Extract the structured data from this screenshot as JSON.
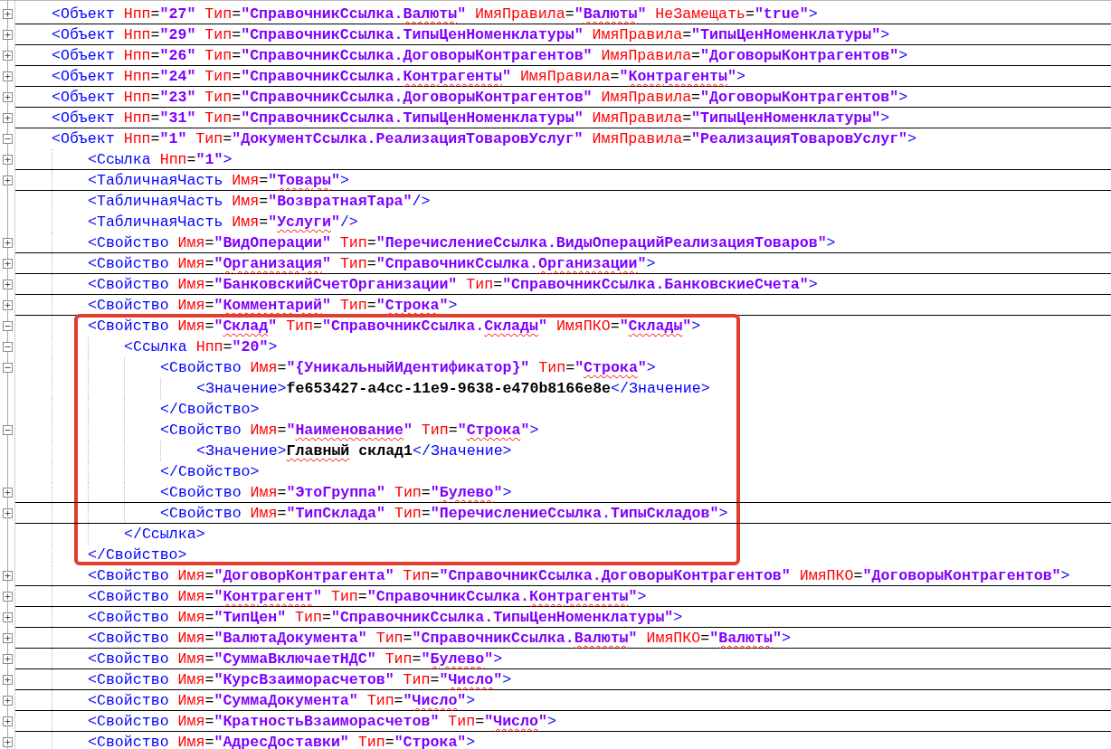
{
  "editor": {
    "lines": [
      {
        "kind": "fold",
        "expanded": false,
        "highlighted": false,
        "tokens": [
          {
            "kind": "tag",
            "text": "<Объект"
          },
          {
            "kind": "attr",
            "text": " Нпп"
          },
          {
            "kind": "eq",
            "text": "="
          },
          {
            "kind": "value",
            "text": "\"27\""
          },
          {
            "kind": "attr",
            "text": " Тип"
          },
          {
            "kind": "eq",
            "text": "="
          },
          {
            "kind": "value",
            "text": "\"СправочникСсылка."
          },
          {
            "kind": "value",
            "text": "Валюты",
            "misspelled": true
          },
          {
            "kind": "value",
            "text": "\""
          },
          {
            "kind": "attr",
            "text": " ИмяПравила"
          },
          {
            "kind": "eq",
            "text": "="
          },
          {
            "kind": "value",
            "text": "\""
          },
          {
            "kind": "value",
            "text": "Валюты",
            "misspelled": true
          },
          {
            "kind": "value",
            "text": "\""
          },
          {
            "kind": "attr",
            "text": " НеЗамещать"
          },
          {
            "kind": "eq",
            "text": "="
          },
          {
            "kind": "value",
            "text": "\"true\""
          },
          {
            "kind": "tag",
            "text": ">"
          }
        ]
      },
      {
        "kind": "fold",
        "expanded": false,
        "highlighted": false,
        "tokens": [
          {
            "kind": "tag",
            "text": "<Объект"
          },
          {
            "kind": "attr",
            "text": " Нпп"
          },
          {
            "kind": "eq",
            "text": "="
          },
          {
            "kind": "value",
            "text": "\"29\""
          },
          {
            "kind": "attr",
            "text": " Тип"
          },
          {
            "kind": "eq",
            "text": "="
          },
          {
            "kind": "value",
            "text": "\"СправочникСсылка.ТипыЦенНоменклатуры\""
          },
          {
            "kind": "attr",
            "text": " ИмяПравила"
          },
          {
            "kind": "eq",
            "text": "="
          },
          {
            "kind": "value",
            "text": "\"ТипыЦенНоменклатуры\""
          },
          {
            "kind": "tag",
            "text": ">"
          }
        ]
      },
      {
        "kind": "fold",
        "expanded": false,
        "highlighted": false,
        "tokens": [
          {
            "kind": "tag",
            "text": "<Объект"
          },
          {
            "kind": "attr",
            "text": " Нпп"
          },
          {
            "kind": "eq",
            "text": "="
          },
          {
            "kind": "value",
            "text": "\"26\""
          },
          {
            "kind": "attr",
            "text": " Тип"
          },
          {
            "kind": "eq",
            "text": "="
          },
          {
            "kind": "value",
            "text": "\"СправочникСсылка.ДоговорыКонтрагентов\""
          },
          {
            "kind": "attr",
            "text": " ИмяПравила"
          },
          {
            "kind": "eq",
            "text": "="
          },
          {
            "kind": "value",
            "text": "\"ДоговорыКонтрагентов\""
          },
          {
            "kind": "tag",
            "text": ">"
          }
        ]
      },
      {
        "kind": "fold",
        "expanded": false,
        "highlighted": false,
        "tokens": [
          {
            "kind": "tag",
            "text": "<Объект"
          },
          {
            "kind": "attr",
            "text": " Нпп"
          },
          {
            "kind": "eq",
            "text": "="
          },
          {
            "kind": "value",
            "text": "\"24\""
          },
          {
            "kind": "attr",
            "text": " Тип"
          },
          {
            "kind": "eq",
            "text": "="
          },
          {
            "kind": "value",
            "text": "\"СправочникСсылка."
          },
          {
            "kind": "value",
            "text": "Контрагенты",
            "misspelled": true
          },
          {
            "kind": "value",
            "text": "\""
          },
          {
            "kind": "attr",
            "text": " ИмяПравила"
          },
          {
            "kind": "eq",
            "text": "="
          },
          {
            "kind": "value",
            "text": "\""
          },
          {
            "kind": "value",
            "text": "Контрагенты",
            "misspelled": true
          },
          {
            "kind": "value",
            "text": "\""
          },
          {
            "kind": "tag",
            "text": ">"
          }
        ]
      },
      {
        "kind": "fold",
        "expanded": false,
        "highlighted": false,
        "tokens": [
          {
            "kind": "tag",
            "text": "<Объект"
          },
          {
            "kind": "attr",
            "text": " Нпп"
          },
          {
            "kind": "eq",
            "text": "="
          },
          {
            "kind": "value",
            "text": "\"23\""
          },
          {
            "kind": "attr",
            "text": " Тип"
          },
          {
            "kind": "eq",
            "text": "="
          },
          {
            "kind": "value",
            "text": "\"СправочникСсылка.ДоговорыКонтрагентов\""
          },
          {
            "kind": "attr",
            "text": " ИмяПравила"
          },
          {
            "kind": "eq",
            "text": "="
          },
          {
            "kind": "value",
            "text": "\"ДоговорыКонтрагентов\""
          },
          {
            "kind": "tag",
            "text": ">"
          }
        ]
      },
      {
        "kind": "fold",
        "expanded": false,
        "highlighted": false,
        "tokens": [
          {
            "kind": "tag",
            "text": "<Объект"
          },
          {
            "kind": "attr",
            "text": " Нпп"
          },
          {
            "kind": "eq",
            "text": "="
          },
          {
            "kind": "value",
            "text": "\"31\""
          },
          {
            "kind": "attr",
            "text": " Тип"
          },
          {
            "kind": "eq",
            "text": "="
          },
          {
            "kind": "value",
            "text": "\"СправочникСсылка.ТипыЦенНоменклатуры\""
          },
          {
            "kind": "attr",
            "text": " ИмяПравила"
          },
          {
            "kind": "eq",
            "text": "="
          },
          {
            "kind": "value",
            "text": "\"ТипыЦенНоменклатуры\""
          },
          {
            "kind": "tag",
            "text": ">"
          }
        ]
      },
      {
        "kind": "fold",
        "expanded": true,
        "highlighted": false,
        "tokens": [
          {
            "kind": "tag",
            "text": "<Объект"
          },
          {
            "kind": "attr",
            "text": " Нпп"
          },
          {
            "kind": "eq",
            "text": "="
          },
          {
            "kind": "value",
            "text": "\"1\""
          },
          {
            "kind": "attr",
            "text": " Тип"
          },
          {
            "kind": "eq",
            "text": "="
          },
          {
            "kind": "value",
            "text": "\"ДокументСсылка.РеализацияТоваровУслуг\""
          },
          {
            "kind": "attr",
            "text": " ИмяПравила"
          },
          {
            "kind": "eq",
            "text": "="
          },
          {
            "kind": "value",
            "text": "\"РеализацияТоваровУслуг\""
          },
          {
            "kind": "tag",
            "text": ">"
          }
        ],
        "children": [
          {
            "kind": "fold",
            "expanded": false,
            "highlighted": false,
            "tokens": [
              {
                "kind": "tag",
                "text": "<Ссылка"
              },
              {
                "kind": "attr",
                "text": " Нпп"
              },
              {
                "kind": "eq",
                "text": "="
              },
              {
                "kind": "value",
                "text": "\"1\""
              },
              {
                "kind": "tag",
                "text": ">"
              }
            ]
          },
          {
            "kind": "fold",
            "expanded": false,
            "highlighted": false,
            "tokens": [
              {
                "kind": "tag",
                "text": "<ТабличнаяЧасть"
              },
              {
                "kind": "attr",
                "text": " Имя"
              },
              {
                "kind": "eq",
                "text": "="
              },
              {
                "kind": "value",
                "text": "\""
              },
              {
                "kind": "value",
                "text": "Товары",
                "misspelled": true
              },
              {
                "kind": "value",
                "text": "\""
              },
              {
                "kind": "tag",
                "text": ">"
              }
            ]
          },
          {
            "kind": "leaf",
            "highlighted": false,
            "tokens": [
              {
                "kind": "tag",
                "text": "<ТабличнаяЧасть"
              },
              {
                "kind": "attr",
                "text": " Имя"
              },
              {
                "kind": "eq",
                "text": "="
              },
              {
                "kind": "value",
                "text": "\"ВозвратнаяТара\""
              },
              {
                "kind": "tag",
                "text": "/>"
              }
            ]
          },
          {
            "kind": "leaf",
            "highlighted": false,
            "tokens": [
              {
                "kind": "tag",
                "text": "<ТабличнаяЧасть"
              },
              {
                "kind": "attr",
                "text": " Имя"
              },
              {
                "kind": "eq",
                "text": "="
              },
              {
                "kind": "value",
                "text": "\""
              },
              {
                "kind": "value",
                "text": "Услуги",
                "misspelled": true
              },
              {
                "kind": "value",
                "text": "\""
              },
              {
                "kind": "tag",
                "text": "/>"
              }
            ]
          },
          {
            "kind": "fold",
            "expanded": false,
            "highlighted": false,
            "tokens": [
              {
                "kind": "tag",
                "text": "<Свойство"
              },
              {
                "kind": "attr",
                "text": " Имя"
              },
              {
                "kind": "eq",
                "text": "="
              },
              {
                "kind": "value",
                "text": "\"ВидОперации\""
              },
              {
                "kind": "attr",
                "text": " Тип"
              },
              {
                "kind": "eq",
                "text": "="
              },
              {
                "kind": "value",
                "text": "\"ПеречислениеСсылка.ВидыОперацийРеализацияТоваров\""
              },
              {
                "kind": "tag",
                "text": ">"
              }
            ]
          },
          {
            "kind": "fold",
            "expanded": false,
            "highlighted": false,
            "tokens": [
              {
                "kind": "tag",
                "text": "<Свойство"
              },
              {
                "kind": "attr",
                "text": " Имя"
              },
              {
                "kind": "eq",
                "text": "="
              },
              {
                "kind": "value",
                "text": "\""
              },
              {
                "kind": "value",
                "text": "Организация",
                "misspelled": true
              },
              {
                "kind": "value",
                "text": "\""
              },
              {
                "kind": "attr",
                "text": " Тип"
              },
              {
                "kind": "eq",
                "text": "="
              },
              {
                "kind": "value",
                "text": "\"СправочникСсылка."
              },
              {
                "kind": "value",
                "text": "Организации",
                "misspelled": true
              },
              {
                "kind": "value",
                "text": "\""
              },
              {
                "kind": "tag",
                "text": ">"
              }
            ]
          },
          {
            "kind": "fold",
            "expanded": false,
            "highlighted": false,
            "tokens": [
              {
                "kind": "tag",
                "text": "<Свойство"
              },
              {
                "kind": "attr",
                "text": " Имя"
              },
              {
                "kind": "eq",
                "text": "="
              },
              {
                "kind": "value",
                "text": "\"БанковскийСчетОрганизации\""
              },
              {
                "kind": "attr",
                "text": " Тип"
              },
              {
                "kind": "eq",
                "text": "="
              },
              {
                "kind": "value",
                "text": "\"СправочникСсылка.БанковскиеСчета\""
              },
              {
                "kind": "tag",
                "text": ">"
              }
            ]
          },
          {
            "kind": "fold",
            "expanded": false,
            "highlighted": false,
            "tokens": [
              {
                "kind": "tag",
                "text": "<Свойство"
              },
              {
                "kind": "attr",
                "text": " Имя"
              },
              {
                "kind": "eq",
                "text": "="
              },
              {
                "kind": "value",
                "text": "\""
              },
              {
                "kind": "value",
                "text": "Комментарий",
                "misspelled": true
              },
              {
                "kind": "value",
                "text": "\""
              },
              {
                "kind": "attr",
                "text": " Тип"
              },
              {
                "kind": "eq",
                "text": "="
              },
              {
                "kind": "value",
                "text": "\""
              },
              {
                "kind": "value",
                "text": "Строка",
                "misspelled": true
              },
              {
                "kind": "value",
                "text": "\""
              },
              {
                "kind": "tag",
                "text": ">"
              }
            ]
          },
          {
            "kind": "fold",
            "expanded": true,
            "highlighted": true,
            "tokens": [
              {
                "kind": "tag",
                "text": "<Свойство"
              },
              {
                "kind": "attr",
                "text": " Имя"
              },
              {
                "kind": "eq",
                "text": "="
              },
              {
                "kind": "value",
                "text": "\""
              },
              {
                "kind": "value",
                "text": "Склад",
                "misspelled": true
              },
              {
                "kind": "value",
                "text": "\""
              },
              {
                "kind": "attr",
                "text": " Тип"
              },
              {
                "kind": "eq",
                "text": "="
              },
              {
                "kind": "value",
                "text": "\"СправочникСсылка."
              },
              {
                "kind": "value",
                "text": "Склады",
                "misspelled": true
              },
              {
                "kind": "value",
                "text": "\""
              },
              {
                "kind": "attr",
                "text": " ИмяПКО"
              },
              {
                "kind": "eq",
                "text": "="
              },
              {
                "kind": "value",
                "text": "\""
              },
              {
                "kind": "value",
                "text": "Склады",
                "misspelled": true
              },
              {
                "kind": "value",
                "text": "\""
              },
              {
                "kind": "tag",
                "text": ">"
              }
            ],
            "children": [
              {
                "kind": "fold",
                "expanded": true,
                "highlighted": false,
                "tokens": [
                  {
                    "kind": "tag",
                    "text": "<Ссылка"
                  },
                  {
                    "kind": "attr",
                    "text": " Нпп"
                  },
                  {
                    "kind": "eq",
                    "text": "="
                  },
                  {
                    "kind": "value",
                    "text": "\"20\""
                  },
                  {
                    "kind": "tag",
                    "text": ">"
                  }
                ],
                "children": [
                  {
                    "kind": "fold",
                    "expanded": true,
                    "highlighted": false,
                    "tokens": [
                      {
                        "kind": "tag",
                        "text": "<Свойство"
                      },
                      {
                        "kind": "attr",
                        "text": " Имя"
                      },
                      {
                        "kind": "eq",
                        "text": "="
                      },
                      {
                        "kind": "value",
                        "text": "\"{УникальныйИдентификатор}\""
                      },
                      {
                        "kind": "attr",
                        "text": " Тип"
                      },
                      {
                        "kind": "eq",
                        "text": "="
                      },
                      {
                        "kind": "value",
                        "text": "\""
                      },
                      {
                        "kind": "value",
                        "text": "Строка",
                        "misspelled": true
                      },
                      {
                        "kind": "value",
                        "text": "\""
                      },
                      {
                        "kind": "tag",
                        "text": ">"
                      }
                    ],
                    "children": [
                      {
                        "kind": "leaf",
                        "highlighted": false,
                        "tokens": [
                          {
                            "kind": "tag",
                            "text": "<Значение>"
                          },
                          {
                            "kind": "text",
                            "text": "fe653427-a4cc-11e9-9638-e470b8166e8e"
                          },
                          {
                            "kind": "tag",
                            "text": "</Значение>"
                          }
                        ]
                      }
                    ],
                    "closing": [
                      {
                        "kind": "tag",
                        "text": "</Свойство>"
                      }
                    ]
                  },
                  {
                    "kind": "fold",
                    "expanded": true,
                    "highlighted": false,
                    "tokens": [
                      {
                        "kind": "tag",
                        "text": "<Свойство"
                      },
                      {
                        "kind": "attr",
                        "text": " Имя"
                      },
                      {
                        "kind": "eq",
                        "text": "="
                      },
                      {
                        "kind": "value",
                        "text": "\""
                      },
                      {
                        "kind": "value",
                        "text": "Наименование",
                        "misspelled": true
                      },
                      {
                        "kind": "value",
                        "text": "\""
                      },
                      {
                        "kind": "attr",
                        "text": " Тип"
                      },
                      {
                        "kind": "eq",
                        "text": "="
                      },
                      {
                        "kind": "value",
                        "text": "\""
                      },
                      {
                        "kind": "value",
                        "text": "Строка",
                        "misspelled": true
                      },
                      {
                        "kind": "value",
                        "text": "\""
                      },
                      {
                        "kind": "tag",
                        "text": ">"
                      }
                    ],
                    "children": [
                      {
                        "kind": "leaf",
                        "highlighted": false,
                        "tokens": [
                          {
                            "kind": "tag",
                            "text": "<Значение>"
                          },
                          {
                            "kind": "text",
                            "text": "Главный",
                            "misspelled": true
                          },
                          {
                            "kind": "text",
                            "text": " склад1"
                          },
                          {
                            "kind": "tag",
                            "text": "</Значение>"
                          }
                        ]
                      }
                    ],
                    "closing": [
                      {
                        "kind": "tag",
                        "text": "</Свойство>"
                      }
                    ]
                  },
                  {
                    "kind": "fold",
                    "expanded": false,
                    "highlighted": false,
                    "tokens": [
                      {
                        "kind": "tag",
                        "text": "<Свойство"
                      },
                      {
                        "kind": "attr",
                        "text": " Имя"
                      },
                      {
                        "kind": "eq",
                        "text": "="
                      },
                      {
                        "kind": "value",
                        "text": "\"ЭтоГруппа\""
                      },
                      {
                        "kind": "attr",
                        "text": " Тип"
                      },
                      {
                        "kind": "eq",
                        "text": "="
                      },
                      {
                        "kind": "value",
                        "text": "\""
                      },
                      {
                        "kind": "value",
                        "text": "Булево",
                        "misspelled": true
                      },
                      {
                        "kind": "value",
                        "text": "\""
                      },
                      {
                        "kind": "tag",
                        "text": ">"
                      }
                    ]
                  },
                  {
                    "kind": "fold",
                    "expanded": false,
                    "highlighted": false,
                    "tokens": [
                      {
                        "kind": "tag",
                        "text": "<Свойство"
                      },
                      {
                        "kind": "attr",
                        "text": " Имя"
                      },
                      {
                        "kind": "eq",
                        "text": "="
                      },
                      {
                        "kind": "value",
                        "text": "\"ТипСклада\""
                      },
                      {
                        "kind": "attr",
                        "text": " Тип"
                      },
                      {
                        "kind": "eq",
                        "text": "="
                      },
                      {
                        "kind": "value",
                        "text": "\"ПеречислениеСсылка.ТипыСкладов\""
                      },
                      {
                        "kind": "tag",
                        "text": ">"
                      }
                    ]
                  }
                ],
                "closing": [
                  {
                    "kind": "tag",
                    "text": "</Ссылка>"
                  }
                ]
              }
            ],
            "closing": [
              {
                "kind": "tag",
                "text": "</Свойство>"
              }
            ]
          },
          {
            "kind": "fold",
            "expanded": false,
            "highlighted": false,
            "tokens": [
              {
                "kind": "tag",
                "text": "<Свойство"
              },
              {
                "kind": "attr",
                "text": " Имя"
              },
              {
                "kind": "eq",
                "text": "="
              },
              {
                "kind": "value",
                "text": "\"ДоговорКонтрагента\""
              },
              {
                "kind": "attr",
                "text": " Тип"
              },
              {
                "kind": "eq",
                "text": "="
              },
              {
                "kind": "value",
                "text": "\"СправочникСсылка.ДоговорыКонтрагентов\""
              },
              {
                "kind": "attr",
                "text": " ИмяПКО"
              },
              {
                "kind": "eq",
                "text": "="
              },
              {
                "kind": "value",
                "text": "\"ДоговорыКонтрагентов\""
              },
              {
                "kind": "tag",
                "text": ">"
              }
            ]
          },
          {
            "kind": "fold",
            "expanded": false,
            "highlighted": false,
            "tokens": [
              {
                "kind": "tag",
                "text": "<Свойство"
              },
              {
                "kind": "attr",
                "text": " Имя"
              },
              {
                "kind": "eq",
                "text": "="
              },
              {
                "kind": "value",
                "text": "\""
              },
              {
                "kind": "value",
                "text": "Контрагент",
                "misspelled": true
              },
              {
                "kind": "value",
                "text": "\""
              },
              {
                "kind": "attr",
                "text": " Тип"
              },
              {
                "kind": "eq",
                "text": "="
              },
              {
                "kind": "value",
                "text": "\"СправочникСсылка."
              },
              {
                "kind": "value",
                "text": "Контрагенты",
                "misspelled": true
              },
              {
                "kind": "value",
                "text": "\""
              },
              {
                "kind": "tag",
                "text": ">"
              }
            ]
          },
          {
            "kind": "fold",
            "expanded": false,
            "highlighted": false,
            "tokens": [
              {
                "kind": "tag",
                "text": "<Свойство"
              },
              {
                "kind": "attr",
                "text": " Имя"
              },
              {
                "kind": "eq",
                "text": "="
              },
              {
                "kind": "value",
                "text": "\"ТипЦен\""
              },
              {
                "kind": "attr",
                "text": " Тип"
              },
              {
                "kind": "eq",
                "text": "="
              },
              {
                "kind": "value",
                "text": "\"СправочникСсылка.ТипыЦенНоменклатуры\""
              },
              {
                "kind": "tag",
                "text": ">"
              }
            ]
          },
          {
            "kind": "fold",
            "expanded": false,
            "highlighted": false,
            "tokens": [
              {
                "kind": "tag",
                "text": "<Свойство"
              },
              {
                "kind": "attr",
                "text": " Имя"
              },
              {
                "kind": "eq",
                "text": "="
              },
              {
                "kind": "value",
                "text": "\"ВалютаДокумента\""
              },
              {
                "kind": "attr",
                "text": " Тип"
              },
              {
                "kind": "eq",
                "text": "="
              },
              {
                "kind": "value",
                "text": "\"СправочникСсылка."
              },
              {
                "kind": "value",
                "text": "Валюты",
                "misspelled": true
              },
              {
                "kind": "value",
                "text": "\""
              },
              {
                "kind": "attr",
                "text": " ИмяПКО"
              },
              {
                "kind": "eq",
                "text": "="
              },
              {
                "kind": "value",
                "text": "\""
              },
              {
                "kind": "value",
                "text": "Валюты",
                "misspelled": true
              },
              {
                "kind": "value",
                "text": "\""
              },
              {
                "kind": "tag",
                "text": ">"
              }
            ]
          },
          {
            "kind": "fold",
            "expanded": false,
            "highlighted": false,
            "tokens": [
              {
                "kind": "tag",
                "text": "<Свойство"
              },
              {
                "kind": "attr",
                "text": " Имя"
              },
              {
                "kind": "eq",
                "text": "="
              },
              {
                "kind": "value",
                "text": "\"СуммаВключаетНДС\""
              },
              {
                "kind": "attr",
                "text": " Тип"
              },
              {
                "kind": "eq",
                "text": "="
              },
              {
                "kind": "value",
                "text": "\""
              },
              {
                "kind": "value",
                "text": "Булево",
                "misspelled": true
              },
              {
                "kind": "value",
                "text": "\""
              },
              {
                "kind": "tag",
                "text": ">"
              }
            ]
          },
          {
            "kind": "fold",
            "expanded": false,
            "highlighted": false,
            "tokens": [
              {
                "kind": "tag",
                "text": "<Свойство"
              },
              {
                "kind": "attr",
                "text": " Имя"
              },
              {
                "kind": "eq",
                "text": "="
              },
              {
                "kind": "value",
                "text": "\"КурсВзаиморасчетов\""
              },
              {
                "kind": "attr",
                "text": " Тип"
              },
              {
                "kind": "eq",
                "text": "="
              },
              {
                "kind": "value",
                "text": "\""
              },
              {
                "kind": "value",
                "text": "Число",
                "misspelled": true
              },
              {
                "kind": "value",
                "text": "\""
              },
              {
                "kind": "tag",
                "text": ">"
              }
            ]
          },
          {
            "kind": "fold",
            "expanded": false,
            "highlighted": false,
            "tokens": [
              {
                "kind": "tag",
                "text": "<Свойство"
              },
              {
                "kind": "attr",
                "text": " Имя"
              },
              {
                "kind": "eq",
                "text": "="
              },
              {
                "kind": "value",
                "text": "\"СуммаДокумента\""
              },
              {
                "kind": "attr",
                "text": " Тип"
              },
              {
                "kind": "eq",
                "text": "="
              },
              {
                "kind": "value",
                "text": "\""
              },
              {
                "kind": "value",
                "text": "Число",
                "misspelled": true
              },
              {
                "kind": "value",
                "text": "\""
              },
              {
                "kind": "tag",
                "text": ">"
              }
            ]
          },
          {
            "kind": "fold",
            "expanded": false,
            "highlighted": false,
            "tokens": [
              {
                "kind": "tag",
                "text": "<Свойство"
              },
              {
                "kind": "attr",
                "text": " Имя"
              },
              {
                "kind": "eq",
                "text": "="
              },
              {
                "kind": "value",
                "text": "\"КратностьВзаиморасчетов\""
              },
              {
                "kind": "attr",
                "text": " Тип"
              },
              {
                "kind": "eq",
                "text": "="
              },
              {
                "kind": "value",
                "text": "\""
              },
              {
                "kind": "value",
                "text": "Число",
                "misspelled": true
              },
              {
                "kind": "value",
                "text": "\""
              },
              {
                "kind": "tag",
                "text": ">"
              }
            ]
          },
          {
            "kind": "fold",
            "expanded": false,
            "highlighted": false,
            "tokens": [
              {
                "kind": "tag",
                "text": "<Свойство"
              },
              {
                "kind": "attr",
                "text": " Имя"
              },
              {
                "kind": "eq",
                "text": "="
              },
              {
                "kind": "value",
                "text": "\"АдресДоставки\""
              },
              {
                "kind": "attr",
                "text": " Тип"
              },
              {
                "kind": "eq",
                "text": "="
              },
              {
                "kind": "value",
                "text": "\""
              },
              {
                "kind": "value",
                "text": "Строка",
                "misspelled": true
              },
              {
                "kind": "value",
                "text": "\""
              },
              {
                "kind": "tag",
                "text": ">"
              }
            ]
          }
        ]
      }
    ]
  }
}
